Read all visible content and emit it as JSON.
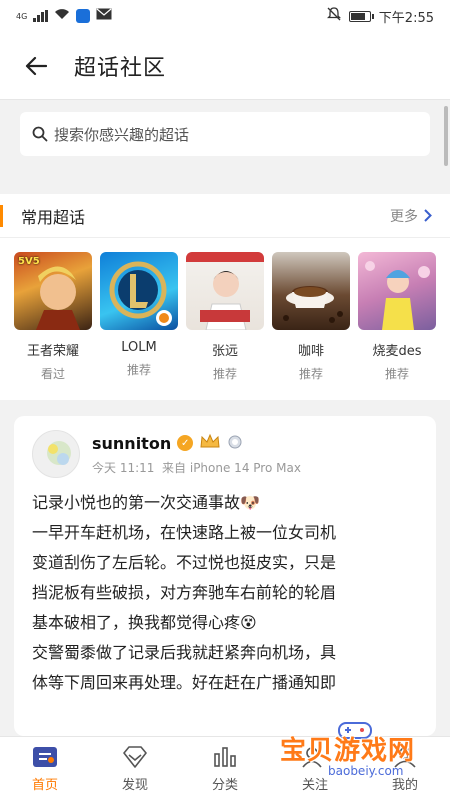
{
  "status": {
    "network": "4G",
    "time": "下午2:55"
  },
  "header": {
    "title": "超话社区"
  },
  "search": {
    "placeholder": "搜索你感兴趣的超话"
  },
  "common": {
    "title": "常用超话",
    "more": "更多",
    "items": [
      {
        "name": "王者荣耀",
        "sub": "看过",
        "badge": "5V5"
      },
      {
        "name": "LOLM",
        "sub": "推荐"
      },
      {
        "name": "张远",
        "sub": "推荐"
      },
      {
        "name": "咖啡",
        "sub": "推荐"
      },
      {
        "name": "烧麦des",
        "sub": "推荐"
      }
    ]
  },
  "post": {
    "username": "sunniton",
    "time": "今天 11:11",
    "source": "来自 iPhone 14 Pro Max",
    "lines": [
      "记录小悦也的第一次交通事故🐶",
      "一早开车赶机场，在快速路上被一位女司机",
      "变道刮伤了左后轮。不过悦也挺皮实，只是",
      "挡泥板有些破损，对方奔驰车右前轮的轮眉",
      "基本破相了，换我都觉得心疼😵",
      "交警蜀黍做了记录后我就赶紧奔向机场，具",
      "体等下周回来再处理。好在赶在广播通知即"
    ]
  },
  "tabs": [
    {
      "label": "首页",
      "icon": "home-icon"
    },
    {
      "label": "发现",
      "icon": "diamond-icon"
    },
    {
      "label": "分类",
      "icon": "bars-icon"
    },
    {
      "label": "关注",
      "icon": "people-icon"
    },
    {
      "label": "我的",
      "icon": "person-icon"
    }
  ],
  "watermark": {
    "text": "宝贝游戏网",
    "url": "baobeiy.com"
  },
  "colors": {
    "accent": "#ff7a00",
    "common_bar": "#ff8a00"
  }
}
